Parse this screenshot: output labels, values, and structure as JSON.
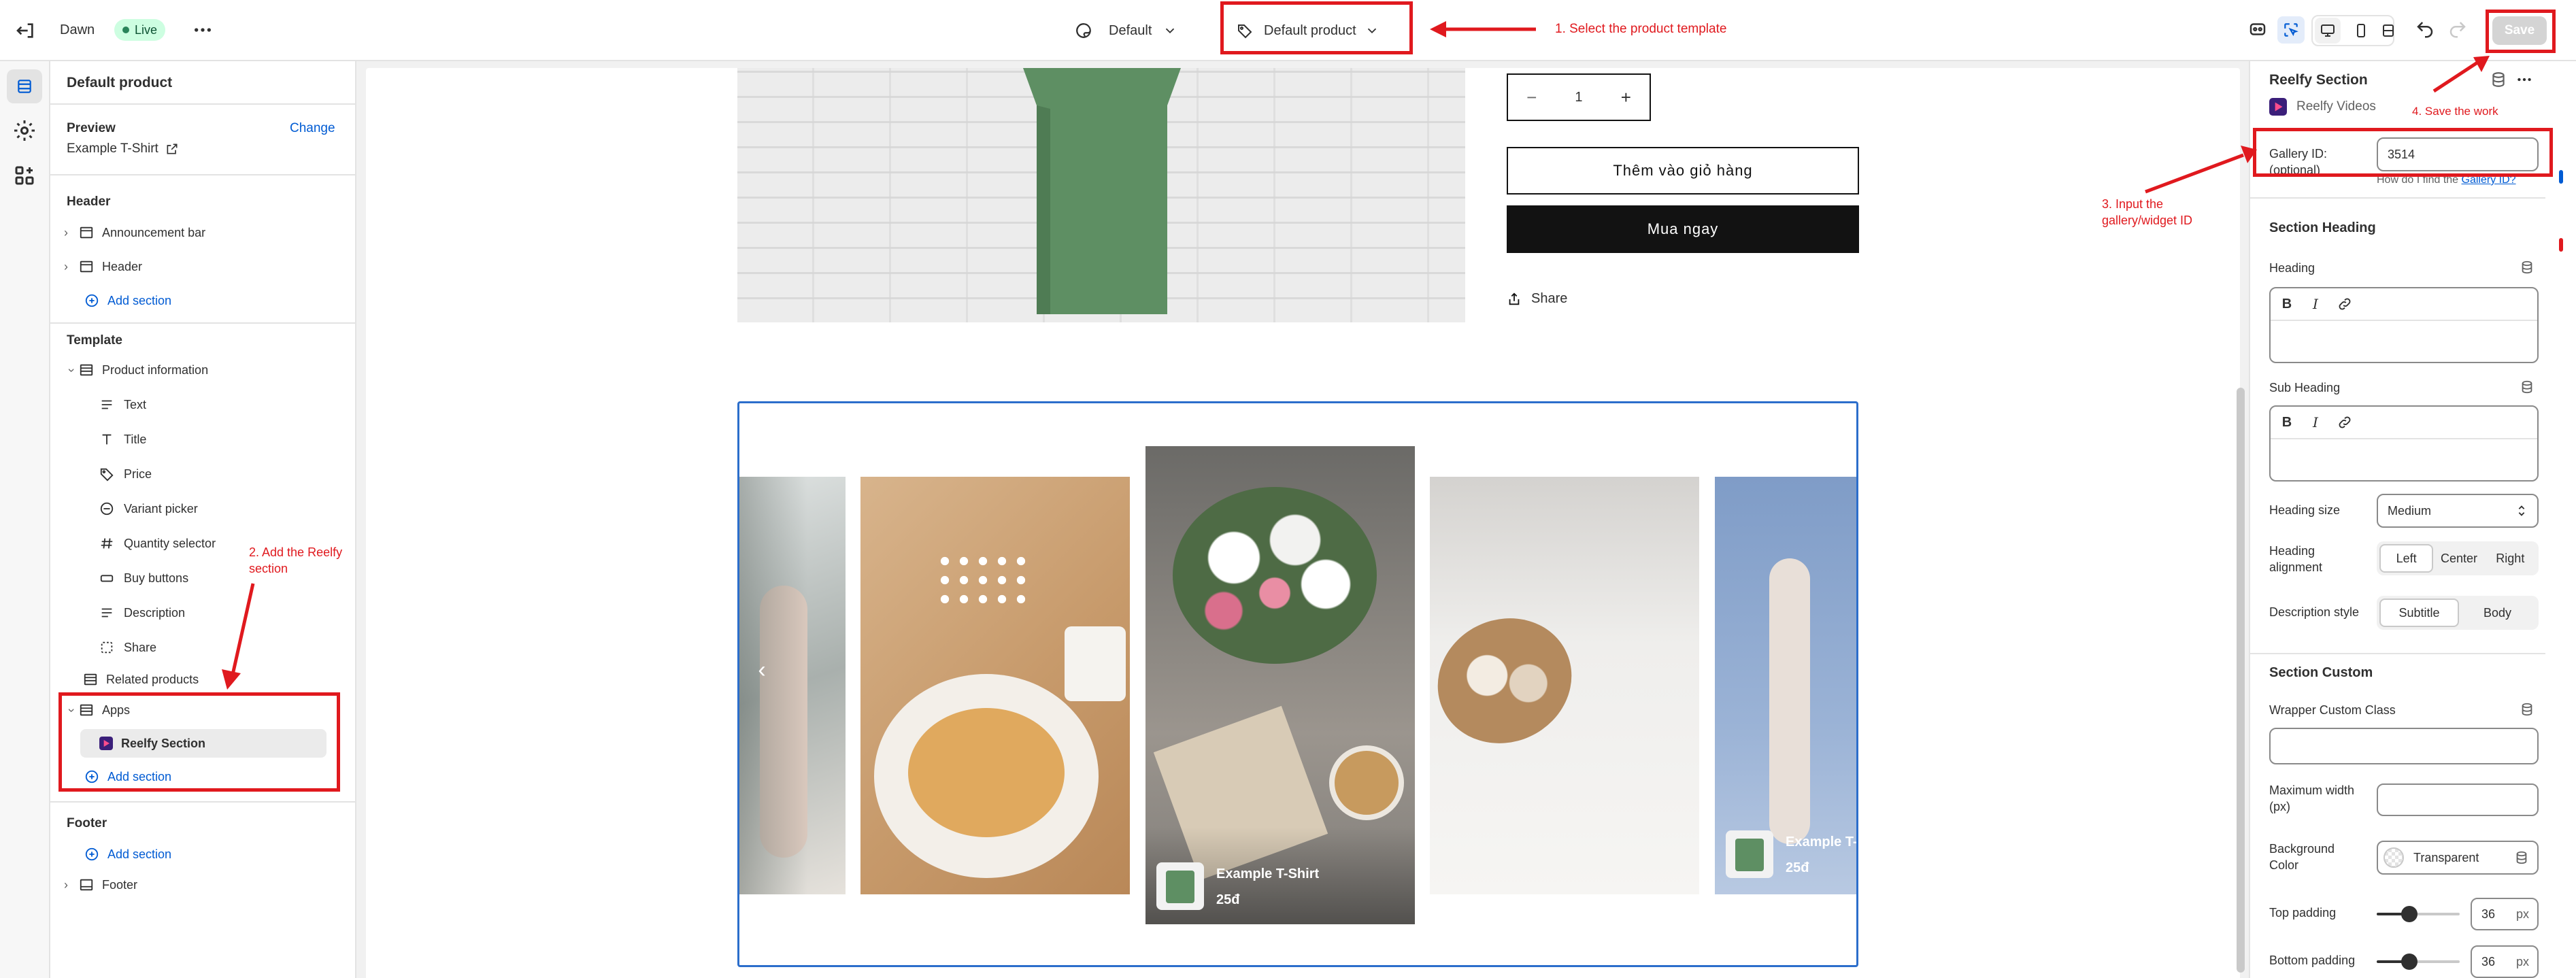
{
  "topbar": {
    "store_name": "Dawn",
    "live_badge": "Live",
    "theme_select": "Default",
    "template_select": "Default product",
    "save_label": "Save"
  },
  "annotations": {
    "step1": "1. Select the product template",
    "step2_line1": "2. Add the Reelfy",
    "step2_line2": "section",
    "step3_line1": "3. Input the",
    "step3_line2": "gallery/widget ID",
    "step4": "4. Save the work",
    "color": "#e0191e"
  },
  "sidebar": {
    "title": "Default product",
    "preview_label": "Preview",
    "preview_change": "Change",
    "preview_value": "Example T-Shirt",
    "header_group": "Header",
    "header_items": [
      "Announcement bar",
      "Header"
    ],
    "add_section": "Add section",
    "template_group": "Template",
    "product_information": "Product information",
    "product_blocks": [
      "Text",
      "Title",
      "Price",
      "Variant picker",
      "Quantity selector",
      "Buy buttons",
      "Description",
      "Share"
    ],
    "related_products": "Related products",
    "apps": "Apps",
    "reelfy_section": "Reelfy Section",
    "footer_group": "Footer",
    "footer_item": "Footer"
  },
  "preview": {
    "quantity": "1",
    "add_to_cart": "Thêm vào giỏ hàng",
    "buy_now": "Mua ngay",
    "share": "Share",
    "card_title": "Example T-Shirt",
    "card_price": "25đ",
    "card_title_cut": "Example T-",
    "card_price_cut": "25đ"
  },
  "panel": {
    "title": "Reelfy Section",
    "app_name": "Reelfy Videos",
    "gallery_label_1": "Gallery ID:",
    "gallery_label_2": "(optional)",
    "gallery_value": "3514",
    "help_prefix": "How do I find the",
    "help_link": "Gallery ID?",
    "section_heading": "Section Heading",
    "heading_label": "Heading",
    "sub_heading_label": "Sub Heading",
    "heading_size_label": "Heading size",
    "heading_size_value": "Medium",
    "heading_alignment_1": "Heading",
    "heading_alignment_2": "alignment",
    "align_options": [
      "Left",
      "Center",
      "Right"
    ],
    "desc_style_label": "Description style",
    "desc_options": [
      "Subtitle",
      "Body"
    ],
    "section_custom": "Section Custom",
    "wrapper_label": "Wrapper Custom Class",
    "max_width_1": "Maximum width",
    "max_width_2": "(px)",
    "bg_color_1": "Background",
    "bg_color_2": "Color",
    "bg_value": "Transparent",
    "top_padding": "Top padding",
    "top_padding_value": "36",
    "bottom_padding": "Bottom padding",
    "bottom_padding_value": "36",
    "unit": "px"
  },
  "colors": {
    "accent": "#005bd3",
    "live_green": "#29845a",
    "selection_blue": "#2c6ecb"
  }
}
